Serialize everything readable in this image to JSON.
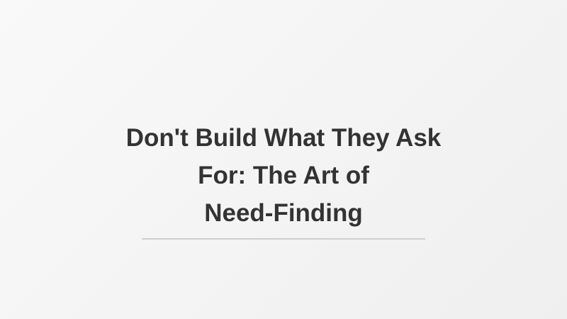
{
  "slide": {
    "title_lines": [
      "Don't Build What They Ask",
      "For: The Art of",
      "Need-Finding"
    ]
  },
  "colors": {
    "background": "#f4f4f4",
    "title": "#333333",
    "divider": "#cfcfcf"
  }
}
